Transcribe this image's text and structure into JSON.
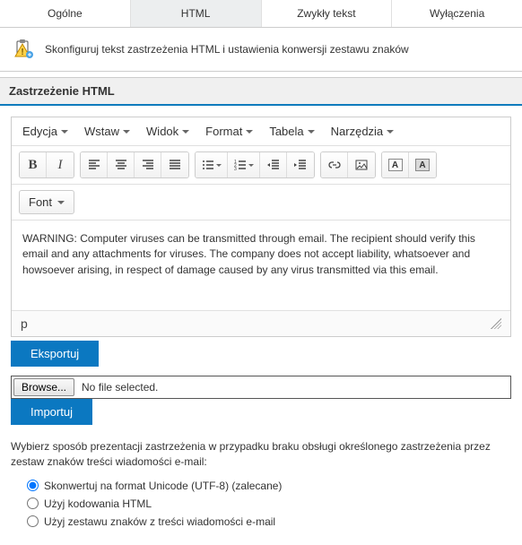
{
  "tabs": {
    "items": [
      "Ogólne",
      "HTML",
      "Zwykły tekst",
      "Wyłączenia"
    ],
    "active_index": 1
  },
  "info": {
    "text": "Skonfiguruj tekst zastrzeżenia HTML i ustawienia konwersji zestawu znaków"
  },
  "section": {
    "title": "Zastrzeżenie HTML"
  },
  "editor": {
    "menus": [
      "Edycja",
      "Wstaw",
      "Widok",
      "Format",
      "Tabela",
      "Narzędzia"
    ],
    "font_label": "Font",
    "content": "WARNING: Computer viruses can be transmitted through email. The recipient should verify this email and any attachments for viruses. The company does not accept liability, whatsoever and howsoever arising, in respect of damage caused by any virus transmitted via this email.",
    "status_path": "p"
  },
  "actions": {
    "export_label": "Eksportuj",
    "browse_label": "Browse...",
    "file_status": "No file selected.",
    "import_label": "Importuj"
  },
  "charset": {
    "help": "Wybierz sposób prezentacji zastrzeżenia w przypadku braku obsługi określonego zastrzeżenia przez zestaw znaków treści wiadomości e-mail:",
    "options": [
      "Skonwertuj na format Unicode (UTF-8) (zalecane)",
      "Użyj kodowania HTML",
      "Użyj zestawu znaków z treści wiadomości e-mail"
    ],
    "selected_index": 0
  }
}
